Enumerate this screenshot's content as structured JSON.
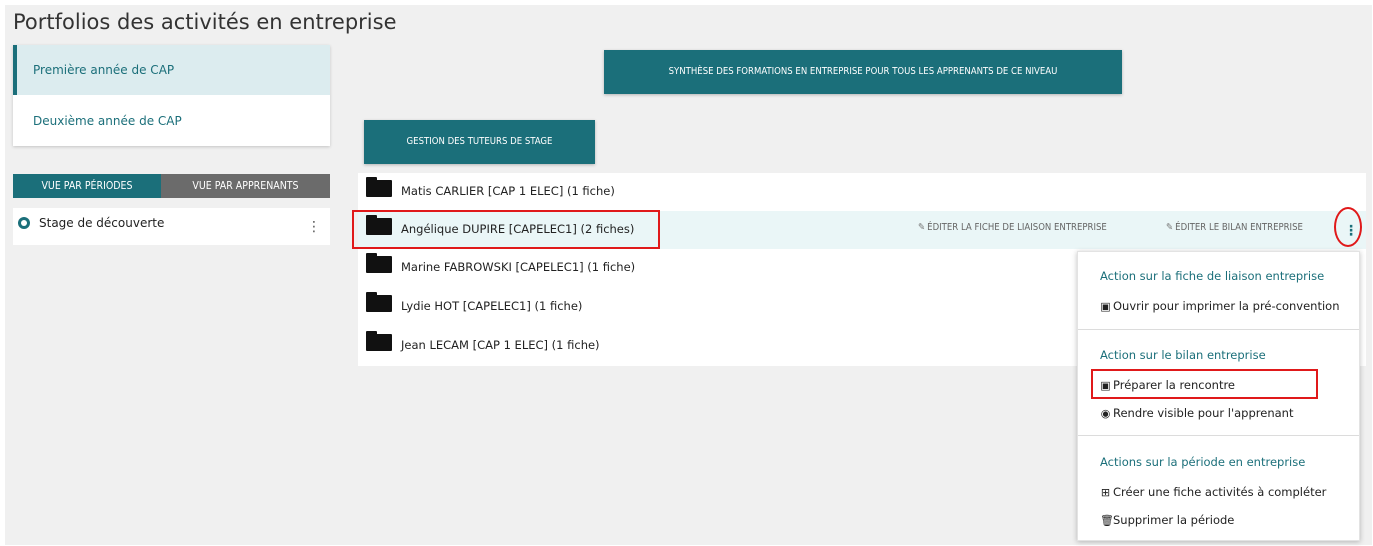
{
  "page": {
    "title": "Portfolios des activités en entreprise"
  },
  "levels": [
    {
      "label": "Première année de CAP",
      "active": true
    },
    {
      "label": "Deuxième année de CAP",
      "active": false
    }
  ],
  "view_tabs": [
    {
      "label": "Vue par périodes",
      "active": true
    },
    {
      "label": "Vue par apprenants",
      "active": false
    }
  ],
  "period": {
    "label": "Stage de découverte"
  },
  "buttons": {
    "synthese": "Synthèse des formations en entreprise pour tous les apprenants de ce niveau",
    "tuteurs": "Gestion des tuteurs de stage"
  },
  "learners": [
    {
      "label": "Matis CARLIER [CAP 1 ELEC] (1 fiche)"
    },
    {
      "label": "Angélique DUPIRE [CAPELEC1] (2 fiches)",
      "highlighted": true
    },
    {
      "label": "Marine FABROWSKI [CAPELEC1] (1 fiche)"
    },
    {
      "label": "Lydie HOT [CAPELEC1] (1 fiche)"
    },
    {
      "label": "Jean LECAM [CAP 1 ELEC] (1 fiche)"
    }
  ],
  "row_actions": {
    "edit_liaison": "Éditer la fiche de liaison entreprise",
    "edit_bilan": "Éditer le bilan entreprise"
  },
  "menu": {
    "section1": {
      "title": "Action sur la fiche de liaison entreprise",
      "items": [
        {
          "label": "Ouvrir pour imprimer la pré-convention",
          "icon": "file-icon"
        }
      ]
    },
    "section2": {
      "title": "Action sur le bilan entreprise",
      "items": [
        {
          "label": "Préparer la rencontre",
          "icon": "pdf-file-icon"
        },
        {
          "label": "Rendre visible pour l'apprenant",
          "icon": "eye-icon"
        }
      ]
    },
    "section3": {
      "title": "Actions sur la période en entreprise",
      "items": [
        {
          "label": "Créer une fiche activités à compléter",
          "icon": "plus-square-icon"
        },
        {
          "label": "Supprimer la période",
          "icon": "trash-icon"
        }
      ]
    }
  },
  "colors": {
    "accent": "#1b6f7a",
    "annotation": "#e0191a",
    "highlight_row": "#eaf6f7"
  }
}
